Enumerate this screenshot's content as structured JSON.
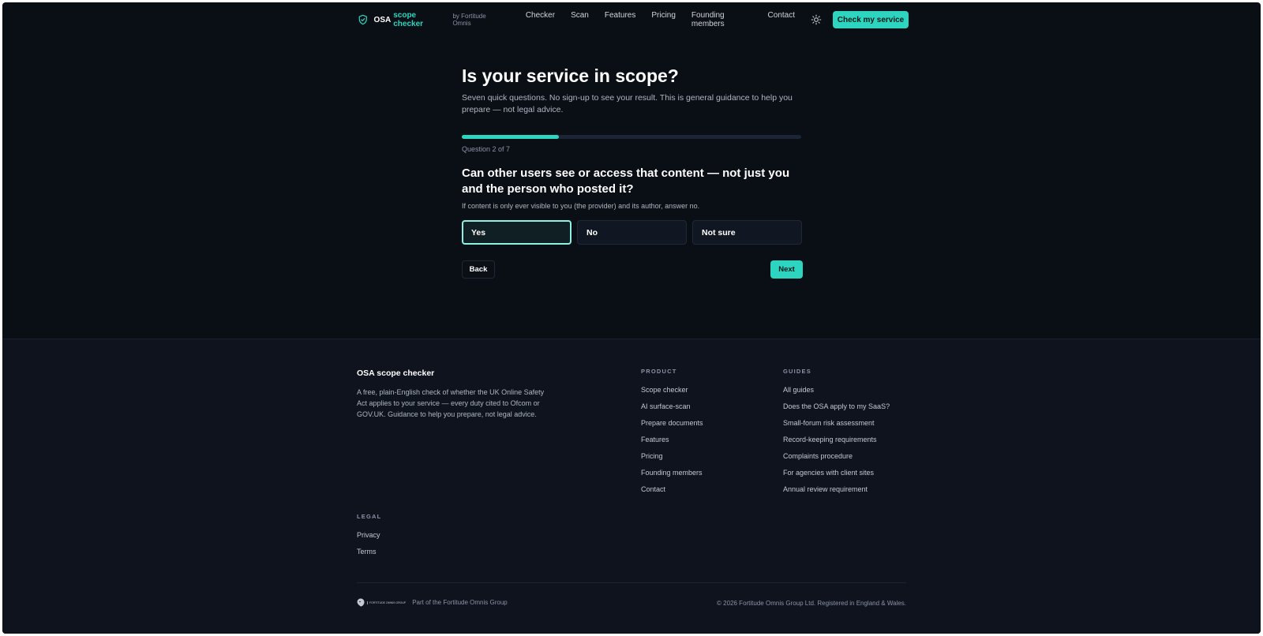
{
  "nav": {
    "brand_name": "OSA",
    "brand_accent": "scope checker",
    "brand_by": "by Fortitude Omnis",
    "links": [
      "Checker",
      "Scan",
      "Features",
      "Pricing",
      "Founding members",
      "Contact"
    ],
    "cta": "Check my service",
    "theme_icon": "sun-icon",
    "shield_icon": "shield-check-icon"
  },
  "main": {
    "title": "Is your service in scope?",
    "subtitle": "Seven quick questions. No sign-up to see your result. This is general guidance to help you prepare — not legal advice.",
    "progress_fraction": 0.2857,
    "question_count": "Question 2 of 7",
    "question": "Can other users see or access that content — not just you and the person who posted it?",
    "hint": "If content is only ever visible to you (the provider) and its author, answer no.",
    "options": [
      "Yes",
      "No",
      "Not sure"
    ],
    "selected_option": "Yes",
    "back_label": "Back",
    "next_label": "Next"
  },
  "footer": {
    "brand": "OSA scope checker",
    "description": "A free, plain-English check of whether the UK Online Safety Act applies to your service — every duty cited to Ofcom or GOV.UK. Guidance to help you prepare, not legal advice.",
    "product_heading": "PRODUCT",
    "product_links": [
      "Scope checker",
      "AI surface-scan",
      "Prepare documents",
      "Features",
      "Pricing",
      "Founding members",
      "Contact"
    ],
    "guides_heading": "GUIDES",
    "guides_links": [
      "All guides",
      "Does the OSA apply to my SaaS?",
      "Small-forum risk assessment",
      "Record-keeping requirements",
      "Complaints procedure",
      "For agencies with client sites",
      "Annual review requirement"
    ],
    "legal_heading": "LEGAL",
    "legal_links": [
      "Privacy",
      "Terms"
    ],
    "logo_text": "FORTITUDE OMNIS GROUP",
    "group_text": "Part of the Fortitude Omnis Group",
    "copyright": "© 2026 Fortitude Omnis Group Ltd. Registered in England & Wales."
  },
  "colors": {
    "background": "#0a0e15",
    "footer_background": "#0e131d",
    "accent": "#2dd4bf",
    "selected_border": "#8ef0e3"
  }
}
